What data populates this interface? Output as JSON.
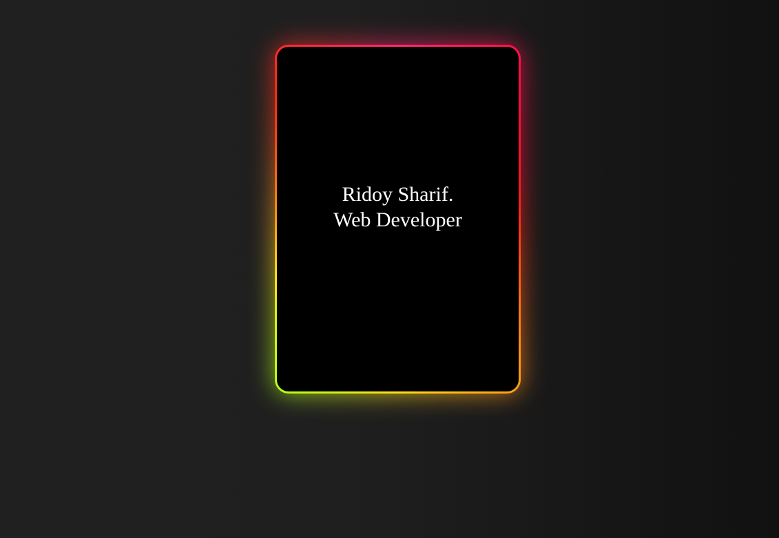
{
  "card": {
    "name": "Ridoy Sharif.",
    "role": "Web Developer"
  },
  "colors": {
    "background": "#1f1f1f",
    "card": "#000000",
    "text": "#ffffff",
    "border_top": "#ff1a4a",
    "border_right": "#ff1a1a",
    "border_bottom": "#ffb414",
    "border_left": "#b6ff14"
  }
}
